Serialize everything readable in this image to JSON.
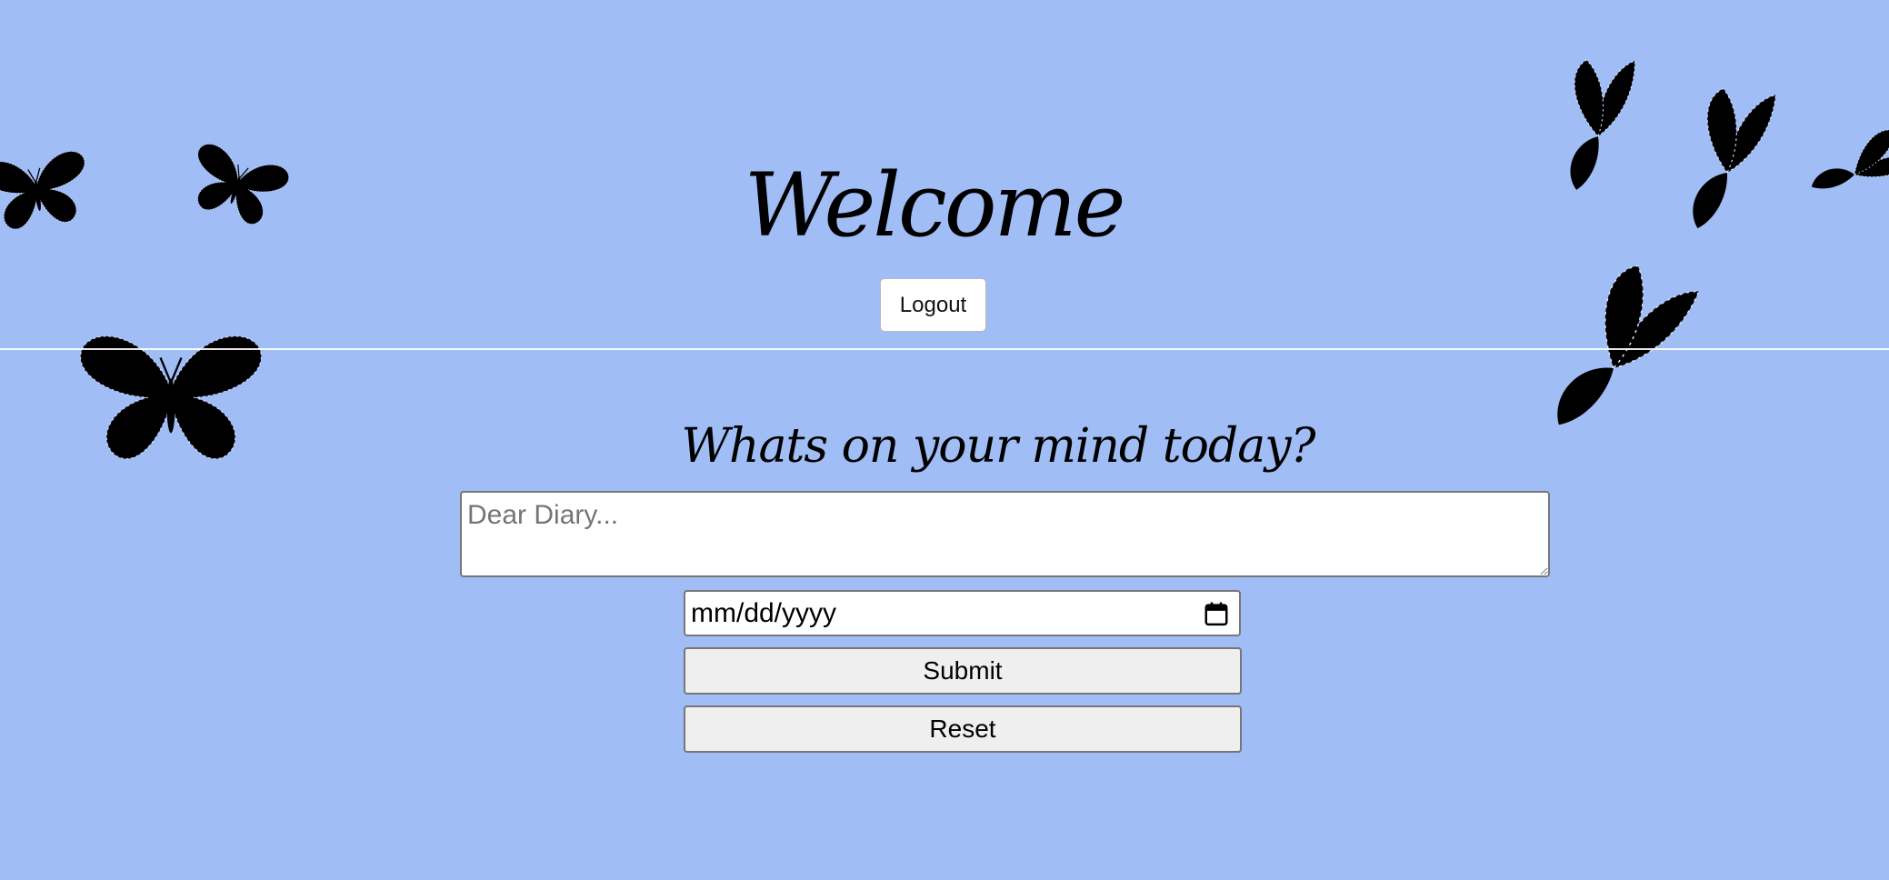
{
  "header": {
    "title": "Welcome",
    "logout_label": "Logout"
  },
  "diary_form": {
    "prompt": "Whats on your mind today?",
    "entry_placeholder": "Dear Diary...",
    "date_placeholder": "mm/dd/yyyy",
    "calendar_icon": "calendar-icon",
    "submit_label": "Submit",
    "reset_label": "Reset"
  },
  "background": {
    "color": "#a0bdf6",
    "decoration_icon": "butterfly-icon"
  }
}
